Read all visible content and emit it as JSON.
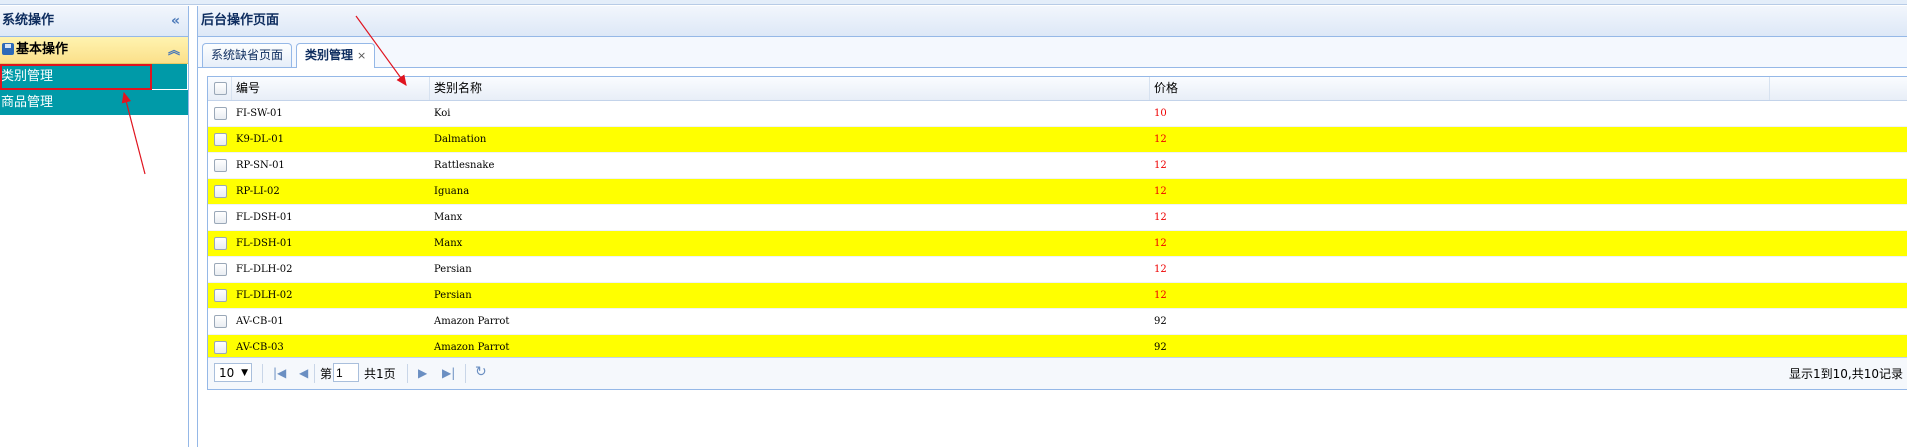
{
  "west": {
    "title": "系统操作",
    "section_title": "基本操作",
    "items": [
      {
        "label": "类别管理",
        "selected": true
      },
      {
        "label": "商品管理",
        "selected": false
      }
    ]
  },
  "center": {
    "title": "后台操作页面",
    "tabs": [
      {
        "label": "系统缺省页面",
        "active": false
      },
      {
        "label": "类别管理",
        "active": true,
        "close": "×"
      }
    ]
  },
  "grid": {
    "columns": [
      "编号",
      "类别名称",
      "价格"
    ],
    "rows": [
      {
        "id": "FI-SW-01",
        "name": "Koi",
        "price": "10"
      },
      {
        "id": "K9-DL-01",
        "name": "Dalmation",
        "price": "12"
      },
      {
        "id": "RP-SN-01",
        "name": "Rattlesnake",
        "price": "12"
      },
      {
        "id": "RP-LI-02",
        "name": "Iguana",
        "price": "12"
      },
      {
        "id": "FL-DSH-01",
        "name": "Manx",
        "price": "12"
      },
      {
        "id": "FL-DSH-01",
        "name": "Manx",
        "price": "12"
      },
      {
        "id": "FL-DLH-02",
        "name": "Persian",
        "price": "12"
      },
      {
        "id": "FL-DLH-02",
        "name": "Persian",
        "price": "12"
      },
      {
        "id": "AV-CB-01",
        "name": "Amazon Parrot",
        "price": "92"
      },
      {
        "id": "AV-CB-03",
        "name": "Amazon Parrot",
        "price": "92"
      }
    ]
  },
  "pager": {
    "page_size": "10",
    "page_prefix": "第",
    "page_value": "1",
    "page_total": "共1页",
    "info": "显示1到10,共10记录"
  },
  "colors": {
    "row_highlight": "#ffff00",
    "menu_teal": "#009aa8",
    "price_red": "#ee0000",
    "annotation_red": "#e0141f"
  }
}
